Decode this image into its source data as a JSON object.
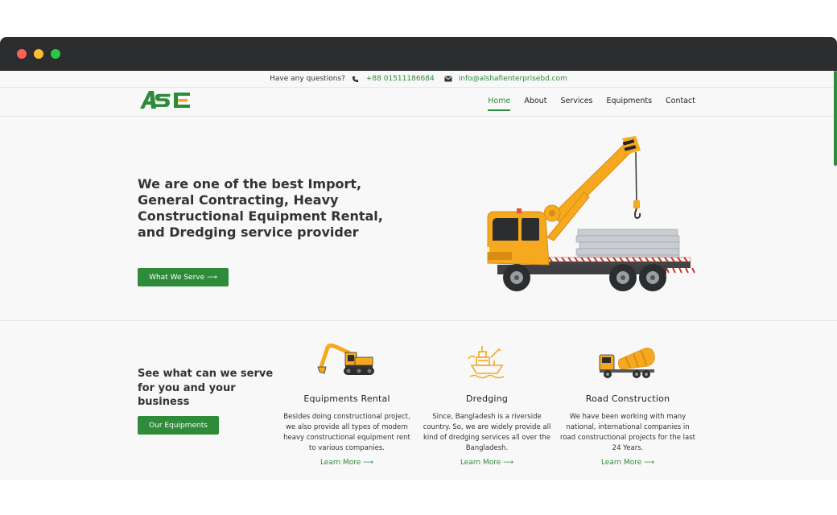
{
  "topbar": {
    "question": "Have any questions?",
    "phone": "+88 01511186684",
    "email": "info@alshafienterprisebd.com"
  },
  "nav": {
    "logo": "ASE",
    "items": [
      "Home",
      "About",
      "Services",
      "Equipments",
      "Contact"
    ],
    "active": "Home"
  },
  "hero": {
    "headline": "We are one of the best Import, General Contracting, Heavy Constructional Equipment Rental, and Dredging service provider",
    "cta": "What We Serve ⟶",
    "image": "crane-truck-illustration"
  },
  "serve": {
    "heading": "See what can we serve for you and your business",
    "cta": "Our Equipments",
    "cards": [
      {
        "icon": "excavator-icon",
        "title": "Equipments Rental",
        "text": "Besides doing constructional project, we also provide all types of modern heavy constructional equipment rent to various companies.",
        "link": "Learn More ⟶"
      },
      {
        "icon": "dredger-ship-icon",
        "title": "Dredging",
        "text": "Since, Bangladesh is a riverside country. So, we are widely provide all kind of dredging services all over the Bangladesh.",
        "link": "Learn More ⟶"
      },
      {
        "icon": "mixer-truck-icon",
        "title": "Road Construction",
        "text": "We have been working with many national, international companies in road constructional projects for the last 24 Years.",
        "link": "Learn More ⟶"
      }
    ]
  },
  "colors": {
    "accent": "#2e8b3a",
    "machine": "#f6a91f",
    "titlebar": "#2b2d2f"
  }
}
